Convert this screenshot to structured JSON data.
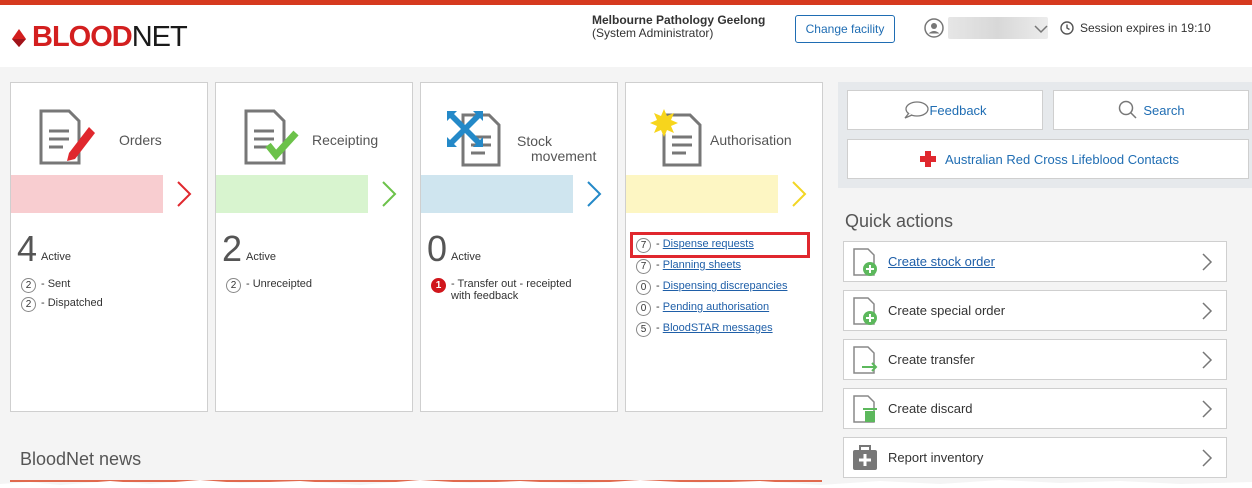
{
  "header": {
    "logo_bold": "BLOOD",
    "logo_light": "NET",
    "facility_name": "Melbourne Pathology Geelong",
    "facility_role": "(System Administrator)",
    "change_facility": "Change facility",
    "session": "Session expires in 19:10"
  },
  "cards": {
    "orders": {
      "title": "Orders",
      "count": "4",
      "count_label": "Active",
      "rows": [
        {
          "count": "2",
          "label": "- Sent"
        },
        {
          "count": "2",
          "label": "- Dispatched"
        }
      ]
    },
    "receipting": {
      "title": "Receipting",
      "count": "2",
      "count_label": "Active",
      "rows": [
        {
          "count": "2",
          "label": "- Unreceipted"
        }
      ]
    },
    "stock": {
      "title_line1": "Stock",
      "title_line2": "movement",
      "count": "0",
      "count_label": "Active",
      "rows": [
        {
          "count": "1",
          "label": "- Transfer out - receipted",
          "label2": "with feedback"
        }
      ]
    },
    "authorisation": {
      "title": "Authorisation",
      "rows": [
        {
          "count": "7",
          "label": "Dispense requests"
        },
        {
          "count": "7",
          "label": "Planning sheets"
        },
        {
          "count": "0",
          "label": "Dispensing discrepancies"
        },
        {
          "count": "0",
          "label": "Pending authorisation"
        },
        {
          "count": "5",
          "label": "BloodSTAR messages"
        }
      ]
    }
  },
  "news_title": "BloodNet news",
  "right": {
    "feedback": "Feedback",
    "search": "Search",
    "contacts": "Australian Red Cross Lifeblood Contacts",
    "quick_actions_title": "Quick actions",
    "quick_actions": [
      {
        "label": "Create stock order"
      },
      {
        "label": "Create special order"
      },
      {
        "label": "Create transfer"
      },
      {
        "label": "Create discard"
      },
      {
        "label": "Report inventory"
      }
    ]
  },
  "colors": {
    "brand_red": "#d31f1f",
    "link_blue": "#1f5fa8",
    "orders_band": "#f8cdd0",
    "receipting_band": "#d8f4cf",
    "stock_band": "#cfe5ef",
    "auth_band": "#fdf6c3"
  }
}
